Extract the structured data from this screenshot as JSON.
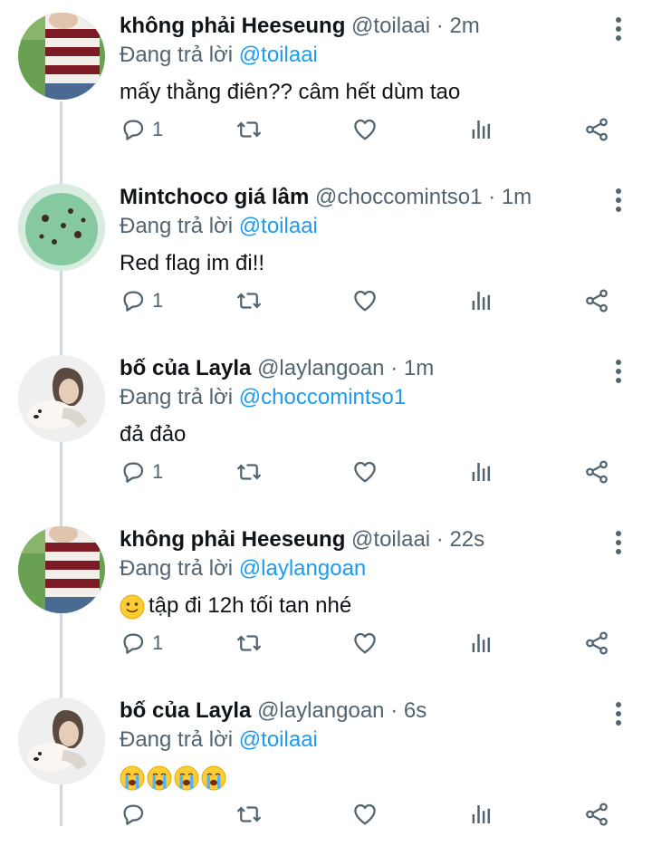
{
  "replying_prefix": "Đang trả lời",
  "icons": {
    "reply": "reply-icon",
    "retweet": "retweet-icon",
    "like": "like-icon",
    "views": "views-icon",
    "share": "share-icon",
    "more": "more-vertical-icon"
  },
  "colors": {
    "link": "#1d9bf0",
    "muted": "#536471",
    "thread": "#cfd9de"
  },
  "tweets": [
    {
      "name": "không phải Heeseung",
      "handle": "@toilaai",
      "time": "· 2m",
      "replying_to": "@toilaai",
      "text": "mấy thằng điên?? câm hết dùm tao",
      "reply_count": "1",
      "avatar": "sweater-avatar"
    },
    {
      "name": "Mintchoco giá lâm",
      "handle": "@choccomintso1",
      "time": "· 1m",
      "replying_to": "@toilaai",
      "text": "Red flag im đi!!",
      "reply_count": "1",
      "avatar": "mint-icecream-avatar"
    },
    {
      "name": "bố của Layla",
      "handle": "@laylangoan",
      "time": "· 1m",
      "replying_to": "@choccomintso1",
      "text": "đả đảo",
      "reply_count": "1",
      "avatar": "person-with-dog-avatar"
    },
    {
      "name": "không phải Heeseung",
      "handle": "@toilaai",
      "time": "· 22s",
      "replying_to": "@laylangoan",
      "text": "tập đi 12h tối tan nhé",
      "text_emoji": "slightly-smiling-face",
      "reply_count": "1",
      "avatar": "sweater-avatar"
    },
    {
      "name": "bố của Layla",
      "handle": "@laylangoan",
      "time": "· 6s",
      "replying_to": "@toilaai",
      "text": "",
      "text_emoji": "loudly-crying-face x4",
      "reply_count": "",
      "avatar": "person-with-dog-avatar"
    }
  ]
}
